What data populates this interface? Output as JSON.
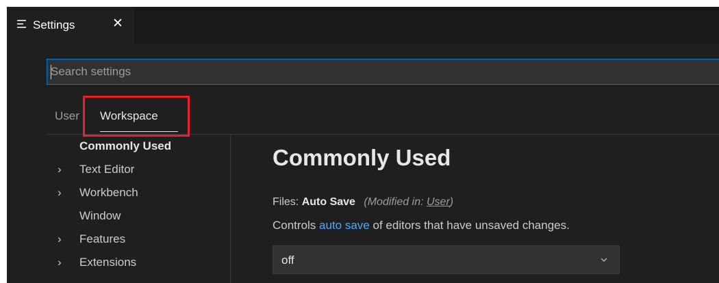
{
  "tab": {
    "label": "Settings",
    "icon": "settings-list-icon",
    "close_glyph": "✕"
  },
  "search": {
    "placeholder": "Search settings",
    "value": ""
  },
  "scope_tabs": {
    "user": "User",
    "workspace": "Workspace",
    "selected": "Workspace"
  },
  "toc": {
    "items": [
      {
        "label": "Commonly Used",
        "expandable": false,
        "active": true
      },
      {
        "label": "Text Editor",
        "expandable": true,
        "active": false
      },
      {
        "label": "Workbench",
        "expandable": true,
        "active": false
      },
      {
        "label": "Window",
        "expandable": false,
        "active": false
      },
      {
        "label": "Features",
        "expandable": true,
        "active": false
      },
      {
        "label": "Extensions",
        "expandable": true,
        "active": false
      }
    ]
  },
  "content": {
    "heading": "Commonly Used",
    "setting": {
      "category": "Files:",
      "name": "Auto Save",
      "modified_prefix": "(Modified in:",
      "modified_link": "User",
      "modified_suffix": ")",
      "desc_before": "Controls",
      "desc_link": "auto save",
      "desc_after": "of editors that have unsaved changes.",
      "value": "off"
    }
  },
  "colors": {
    "accent": "#0078d4",
    "link": "#4daafc",
    "highlight_box": "#e8202c"
  }
}
